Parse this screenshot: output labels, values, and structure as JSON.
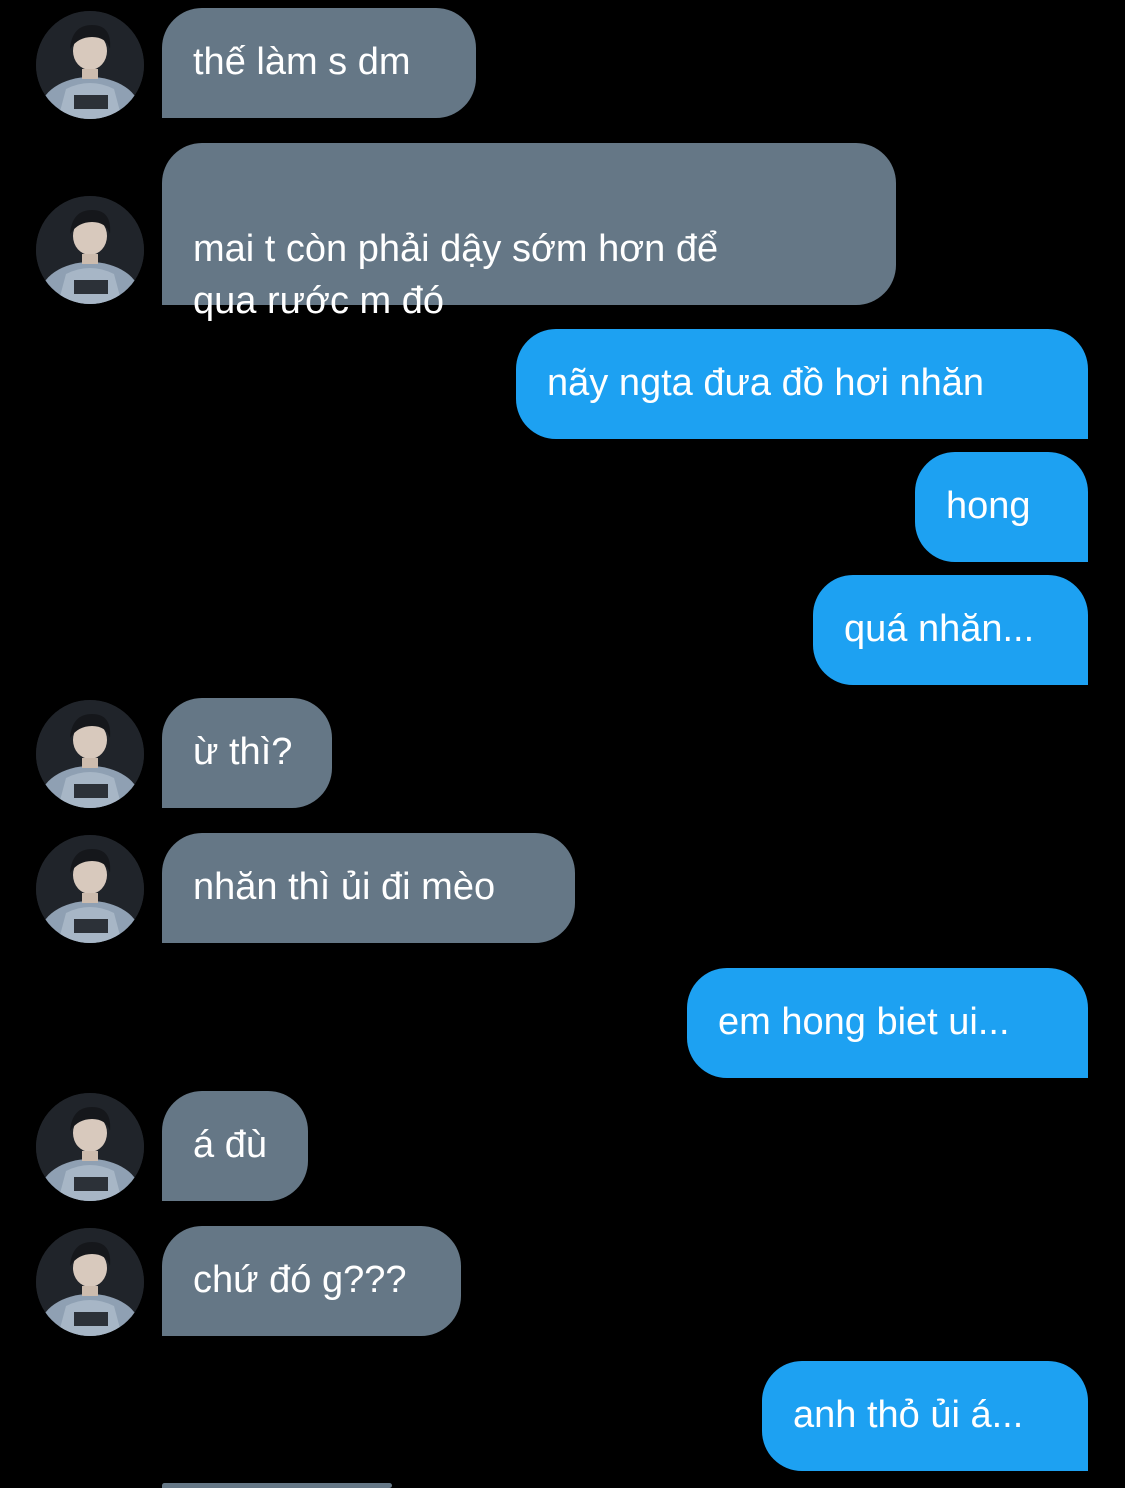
{
  "conversation": {
    "messages": [
      {
        "sender": "them",
        "text": "thế làm s dm"
      },
      {
        "sender": "them",
        "text": "mai t còn phải dậy sớm hơn để\nqua rước m đó"
      },
      {
        "sender": "me",
        "text": "nãy ngta đưa đồ hơi nhăn"
      },
      {
        "sender": "me",
        "text": "hong"
      },
      {
        "sender": "me",
        "text": "quá nhăn..."
      },
      {
        "sender": "them",
        "text": "ừ thì?"
      },
      {
        "sender": "them",
        "text": "nhăn thì ủi đi mèo"
      },
      {
        "sender": "me",
        "text": "em hong biet ui..."
      },
      {
        "sender": "them",
        "text": "á đù"
      },
      {
        "sender": "them",
        "text": "chứ đó g???"
      },
      {
        "sender": "me",
        "text": "anh thỏ ủi á..."
      }
    ]
  },
  "colors": {
    "background": "#000000",
    "incoming_bubble": "#657786",
    "outgoing_bubble": "#1da1f2",
    "text": "#ffffff"
  },
  "icons": {
    "avatar": "contact-avatar-photo"
  }
}
